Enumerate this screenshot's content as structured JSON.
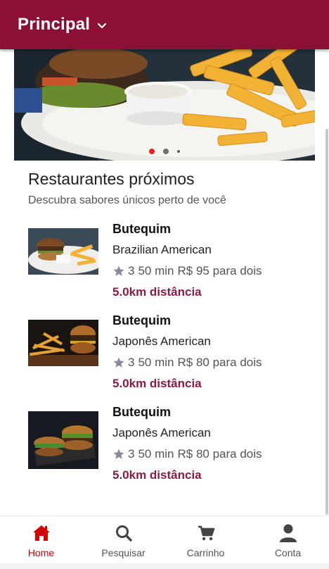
{
  "header": {
    "title": "Principal"
  },
  "hero": {
    "slides": 3,
    "active_index": 0
  },
  "section": {
    "title": "Restaurantes próximos",
    "subtitle": "Descubra sabores únicos perto de você"
  },
  "restaurants": [
    {
      "name": "Butequim",
      "cuisine": "Brazilian American",
      "rating": "3",
      "time": "50 min",
      "price": "R$ 95 para dois",
      "distance": "5.0km distância"
    },
    {
      "name": "Butequim",
      "cuisine": "Japonês American",
      "rating": "3",
      "time": "50 min",
      "price": "R$ 80 para dois",
      "distance": "5.0km distância"
    },
    {
      "name": "Butequim",
      "cuisine": "Japonês American",
      "rating": "3",
      "time": "50 min",
      "price": "R$ 80 para dois",
      "distance": "5.0km distância"
    }
  ],
  "nav": [
    {
      "label": "Home",
      "icon": "home-icon",
      "active": true
    },
    {
      "label": "Pesquisar",
      "icon": "search-icon",
      "active": false
    },
    {
      "label": "Carrinho",
      "icon": "cart-icon",
      "active": false
    },
    {
      "label": "Conta",
      "icon": "person-icon",
      "active": false
    }
  ],
  "colors": {
    "header": "#8b1035",
    "accent": "#d50000",
    "distance": "#8b1a45"
  }
}
